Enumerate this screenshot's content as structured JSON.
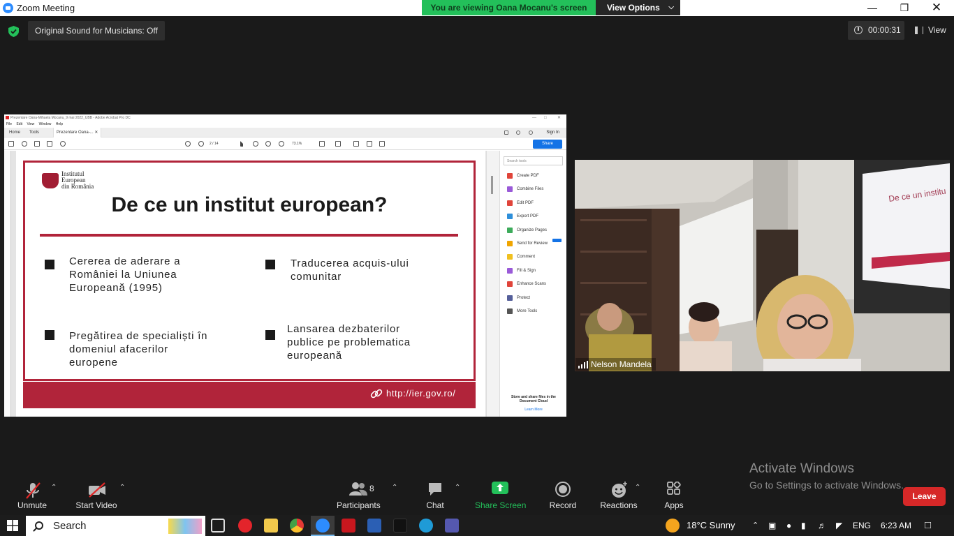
{
  "window": {
    "title": "Zoom Meeting"
  },
  "banner": {
    "viewing_text": "You are viewing Oana Mocanu's screen",
    "view_options_label": "View Options"
  },
  "top_bar": {
    "original_sound": "Original Sound for Musicians: Off",
    "timer": "00:00:31",
    "view_label": "View"
  },
  "shared_pdf": {
    "window_title": "Prezentare Oana-Mihaela Mocanu_9 mai 2022_UBB - Adobe Acrobat Pro DC",
    "menu": [
      "File",
      "Edit",
      "View",
      "Window",
      "Help"
    ],
    "tabs": [
      "Home",
      "Tools",
      "Prezentare Oana-..."
    ],
    "sign_in": "Sign In",
    "page_indicator": "2 / 14",
    "zoom": "73.1%",
    "share_label": "Share",
    "search_placeholder": "Search tools",
    "tools": [
      {
        "label": "Create PDF",
        "color": "#e0443a"
      },
      {
        "label": "Combine Files",
        "color": "#9a5ad8"
      },
      {
        "label": "Edit PDF",
        "color": "#e0443a"
      },
      {
        "label": "Export PDF",
        "color": "#2e8fda"
      },
      {
        "label": "Organize Pages",
        "color": "#3dab5b"
      },
      {
        "label": "Send for Review",
        "color": "#f0a500"
      },
      {
        "label": "Comment",
        "color": "#f0c020"
      },
      {
        "label": "Fill & Sign",
        "color": "#9a5ad8"
      },
      {
        "label": "Enhance Scans",
        "color": "#e0443a"
      },
      {
        "label": "Protect",
        "color": "#555f9a"
      },
      {
        "label": "More Tools",
        "color": "#555555"
      }
    ],
    "cloud_text": "Store and share files in the Document Cloud",
    "learn_more": "Learn More",
    "slide": {
      "logo_line1": "Institutul",
      "logo_line2": "European",
      "logo_line3": "din România",
      "heading": "De ce un institut european?",
      "bullets": [
        [
          "Cererea de aderare a",
          "României la Uniunea",
          "Europeană (1995)"
        ],
        [
          "Traducerea acquis-ului",
          "comunitar"
        ],
        [
          "Pregătirea de specialiști în",
          "domeniul afacerilor",
          "europene"
        ],
        [
          "Lansarea dezbaterilor",
          "publice pe problematica",
          "europeană"
        ]
      ],
      "url": "http://ier.gov.ro/"
    }
  },
  "video": {
    "participant_name": "Nelson Mandela",
    "slide_fragment": "De ce un institu"
  },
  "watermark": {
    "line1": "Activate Windows",
    "line2": "Go to Settings to activate Windows."
  },
  "controls": {
    "unmute": "Unmute",
    "start_video": "Start Video",
    "participants": "Participants",
    "participant_count": "8",
    "chat": "Chat",
    "share_screen": "Share Screen",
    "record": "Record",
    "reactions": "Reactions",
    "apps": "Apps",
    "leave": "Leave"
  },
  "taskbar": {
    "search": "Search",
    "weather": "18°C  Sunny",
    "language": "ENG",
    "time": "6:23 AM"
  },
  "colors": {
    "zoom_green": "#23c05a",
    "zoom_blue": "#2d8cff",
    "slide_red": "#b1243a",
    "leave_red": "#d62828"
  }
}
